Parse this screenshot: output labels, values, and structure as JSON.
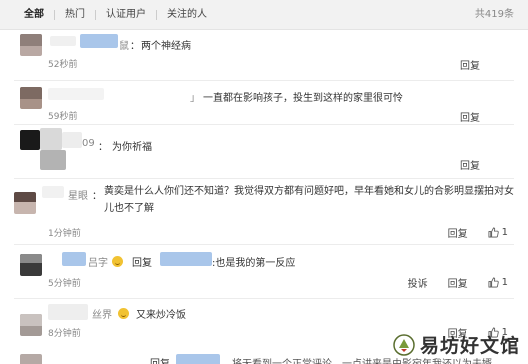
{
  "filter": {
    "tabs": [
      "全部",
      "热门",
      "认证用户",
      "关注的人"
    ],
    "count": "共419条"
  },
  "comments": [
    {
      "name": "鼠",
      "prefix": "：",
      "text": "两个神经病",
      "time": "52秒前",
      "reply": "回复"
    },
    {
      "name": "」",
      "prefix": "",
      "text": "一直都在影响孩子，投生到这样的家里很可怜",
      "time": "59秒前",
      "reply": "回复"
    },
    {
      "name": "09",
      "prefix": "：",
      "text": "为你祈福",
      "time": "",
      "reply": "回复"
    },
    {
      "name": "星眼",
      "prefix": "：",
      "text": "黄奕是什么人你们还不知道？我觉得双方都有问题好吧，早年看她和女儿的合影明显摆拍对女儿也不了解",
      "time": "1分钟前",
      "reply": "回复",
      "likes": "1"
    },
    {
      "name": "吕字",
      "prefix": "",
      "text_reply": "回复",
      "text": ":也是我的第一反应",
      "time": "5分钟前",
      "complain": "投诉",
      "reply": "回复",
      "likes": "1"
    },
    {
      "name": "丝界",
      "prefix": "",
      "text": "又来炒冷饭",
      "time": "8分钟前",
      "reply": "回复",
      "likes": "1"
    },
    {
      "name": "",
      "prefix": "",
      "text_reply": "回复",
      "text": "…将无看到一个正常评论，一点讲来是由影宛年我还以为夫婿",
      "time": "",
      "reply": "",
      "likes": ""
    }
  ],
  "watermark": {
    "text": "易坊好文馆"
  }
}
